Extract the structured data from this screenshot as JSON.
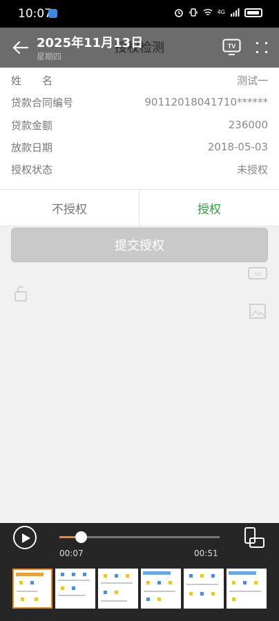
{
  "status_bar": {
    "time": "10:07",
    "network": "4G"
  },
  "header": {
    "date": "2025年11月13日",
    "weekday": "星期四",
    "title": "授权检测"
  },
  "info_rows": [
    {
      "label": "姓　　名",
      "value": "测试一"
    },
    {
      "label": "贷款合同编号",
      "value": "90112018041710******"
    },
    {
      "label": "贷款金额",
      "value": "236000"
    },
    {
      "label": "放款日期",
      "value": "2018-05-03"
    },
    {
      "label": "授权状态",
      "value": "未授权"
    }
  ],
  "auth": {
    "deny_label": "不授权",
    "grant_label": "授权",
    "grant_color": "#2e9f3c"
  },
  "submit_label": "提交授权",
  "player": {
    "current_time": "00:07",
    "duration": "00:51",
    "progress": 0.137,
    "accent": "#f08a1b"
  },
  "icons": {
    "back": "arrow-left-icon",
    "cast": "tv-icon",
    "more": "more-dots-icon",
    "play": "play-icon",
    "rotate": "rotate-screen-icon",
    "subtitle": "subtitle-icon",
    "screenshot": "image-icon",
    "lock": "lock-rotate-icon"
  }
}
